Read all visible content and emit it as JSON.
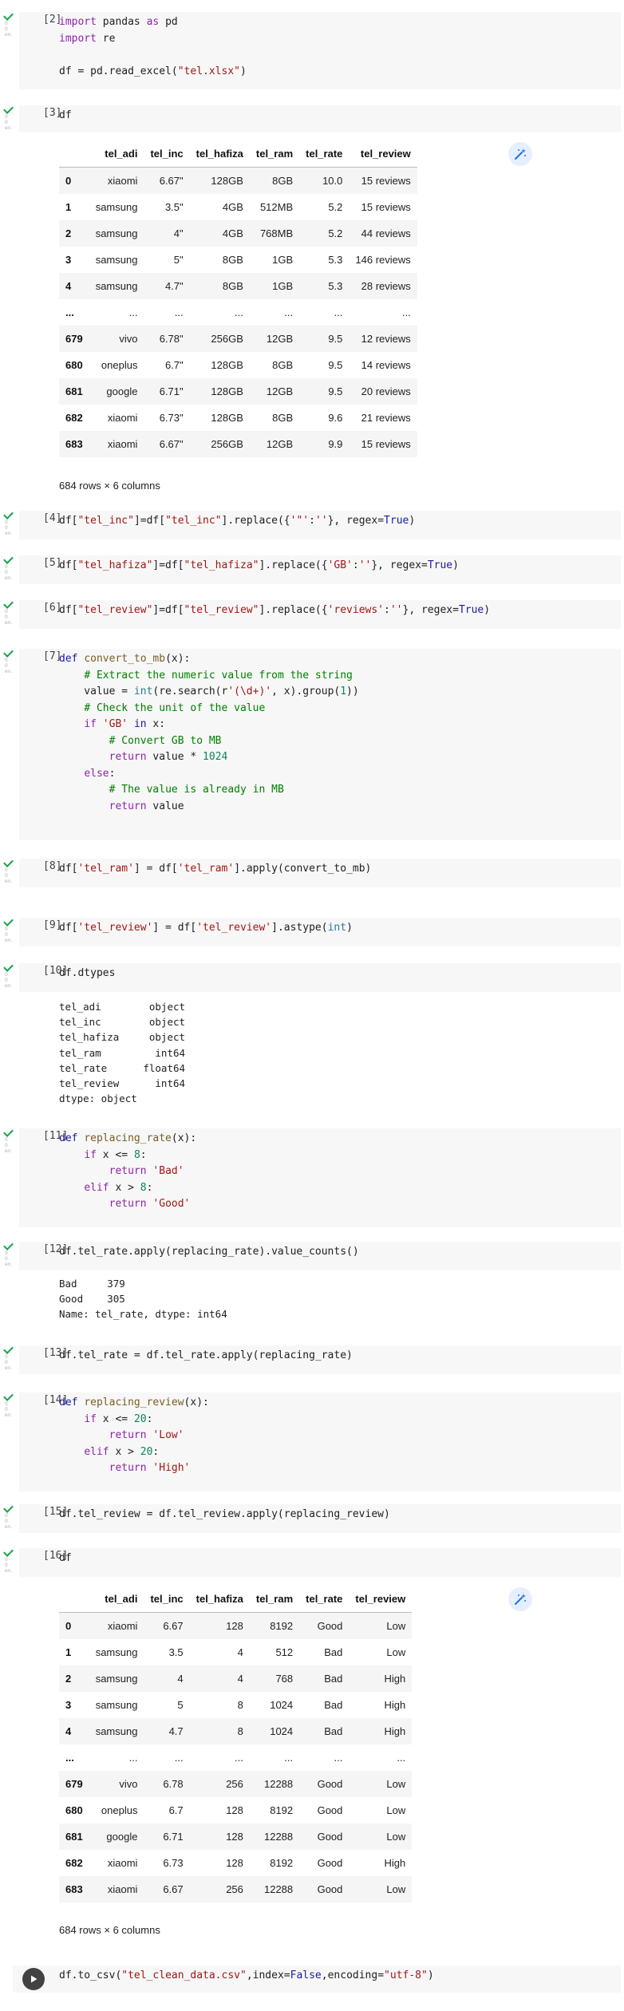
{
  "gutter": {
    "ticks": [
      "0",
      "0",
      "en."
    ]
  },
  "cells": {
    "c2": {
      "number": "[2]"
    },
    "c3": {
      "number": "[3]"
    },
    "c4": {
      "number": "[4]"
    },
    "c5": {
      "number": "[5]"
    },
    "c6": {
      "number": "[6]"
    },
    "c7": {
      "number": "[7]"
    },
    "c8": {
      "number": "[8]"
    },
    "c9": {
      "number": "[9]"
    },
    "c10": {
      "number": "[10]"
    },
    "c11": {
      "number": "[11]"
    },
    "c12": {
      "number": "[12]"
    },
    "c13": {
      "number": "[13]"
    },
    "c14": {
      "number": "[14]"
    },
    "c15": {
      "number": "[15]"
    },
    "c16": {
      "number": "[16]"
    }
  },
  "code": {
    "c2": [
      [
        [
          "k",
          "import"
        ],
        [
          "t",
          " pandas "
        ],
        [
          "k",
          "as"
        ],
        [
          "t",
          " pd"
        ]
      ],
      [
        [
          "k",
          "import"
        ],
        [
          "t",
          " re"
        ]
      ],
      [],
      [
        [
          "t",
          "df = pd.read_excel("
        ],
        [
          "s",
          "\"tel.xlsx\""
        ],
        [
          "t",
          ")"
        ]
      ]
    ],
    "c3": [
      [
        [
          "t",
          "df"
        ]
      ]
    ],
    "c4": [
      [
        [
          "t",
          "df["
        ],
        [
          "s",
          "\"tel_inc\""
        ],
        [
          "t",
          "]=df["
        ],
        [
          "s",
          "\"tel_inc\""
        ],
        [
          "t",
          "].replace({"
        ],
        [
          "s",
          "'\"'"
        ],
        [
          "t",
          ":"
        ],
        [
          "s",
          "''"
        ],
        [
          "t",
          "}, regex="
        ],
        [
          "kb",
          "True"
        ],
        [
          "t",
          ")"
        ]
      ]
    ],
    "c5": [
      [
        [
          "t",
          "df["
        ],
        [
          "s",
          "\"tel_hafiza\""
        ],
        [
          "t",
          "]=df["
        ],
        [
          "s",
          "\"tel_hafiza\""
        ],
        [
          "t",
          "].replace({"
        ],
        [
          "s",
          "'GB'"
        ],
        [
          "t",
          ":"
        ],
        [
          "s",
          "''"
        ],
        [
          "t",
          "}, regex="
        ],
        [
          "kb",
          "True"
        ],
        [
          "t",
          ")"
        ]
      ]
    ],
    "c6": [
      [
        [
          "t",
          "df["
        ],
        [
          "s",
          "\"tel_review\""
        ],
        [
          "t",
          "]=df["
        ],
        [
          "s",
          "\"tel_review\""
        ],
        [
          "t",
          "].replace({"
        ],
        [
          "s",
          "'reviews'"
        ],
        [
          "t",
          ":"
        ],
        [
          "s",
          "''"
        ],
        [
          "t",
          "}, regex="
        ],
        [
          "kb",
          "True"
        ],
        [
          "t",
          ")"
        ]
      ]
    ],
    "c7": [
      [
        [
          "kb",
          "def"
        ],
        [
          "t",
          " "
        ],
        [
          "fn",
          "convert_to_mb"
        ],
        [
          "t",
          "(x):"
        ]
      ],
      [
        [
          "t",
          "    "
        ],
        [
          "c",
          "# Extract the numeric value from the string"
        ]
      ],
      [
        [
          "t",
          "    value = "
        ],
        [
          "bi",
          "int"
        ],
        [
          "t",
          "(re.search(r"
        ],
        [
          "s",
          "'(\\d+)'"
        ],
        [
          "t",
          ", x).group("
        ],
        [
          "n",
          "1"
        ],
        [
          "t",
          "))"
        ]
      ],
      [
        [
          "t",
          "    "
        ],
        [
          "c",
          "# Check the unit of the value"
        ]
      ],
      [
        [
          "t",
          "    "
        ],
        [
          "k",
          "if"
        ],
        [
          "t",
          " "
        ],
        [
          "s",
          "'GB'"
        ],
        [
          "t",
          " "
        ],
        [
          "kb",
          "in"
        ],
        [
          "t",
          " x:"
        ]
      ],
      [
        [
          "t",
          "        "
        ],
        [
          "c",
          "# Convert GB to MB"
        ]
      ],
      [
        [
          "t",
          "        "
        ],
        [
          "k",
          "return"
        ],
        [
          "t",
          " value * "
        ],
        [
          "n",
          "1024"
        ]
      ],
      [
        [
          "t",
          "    "
        ],
        [
          "k",
          "else"
        ],
        [
          "t",
          ":"
        ]
      ],
      [
        [
          "t",
          "        "
        ],
        [
          "c",
          "# The value is already in MB"
        ]
      ],
      [
        [
          "t",
          "        "
        ],
        [
          "k",
          "return"
        ],
        [
          "t",
          " value"
        ]
      ]
    ],
    "c8": [
      [
        [
          "t",
          "df["
        ],
        [
          "s",
          "'tel_ram'"
        ],
        [
          "t",
          "] = df["
        ],
        [
          "s",
          "'tel_ram'"
        ],
        [
          "t",
          "].apply(convert_to_mb)"
        ]
      ]
    ],
    "c9": [
      [
        [
          "t",
          "df["
        ],
        [
          "s",
          "'tel_review'"
        ],
        [
          "t",
          "] = df["
        ],
        [
          "s",
          "'tel_review'"
        ],
        [
          "t",
          "].astype("
        ],
        [
          "bi",
          "int"
        ],
        [
          "t",
          ")"
        ]
      ]
    ],
    "c10": [
      [
        [
          "t",
          "df.dtypes"
        ]
      ]
    ],
    "c11": [
      [
        [
          "kb",
          "def"
        ],
        [
          "t",
          " "
        ],
        [
          "fn",
          "replacing_rate"
        ],
        [
          "t",
          "(x):"
        ]
      ],
      [
        [
          "t",
          "    "
        ],
        [
          "k",
          "if"
        ],
        [
          "t",
          " x <= "
        ],
        [
          "n",
          "8"
        ],
        [
          "t",
          ":"
        ]
      ],
      [
        [
          "t",
          "        "
        ],
        [
          "k",
          "return"
        ],
        [
          "t",
          " "
        ],
        [
          "s",
          "'Bad'"
        ]
      ],
      [
        [
          "t",
          "    "
        ],
        [
          "k",
          "elif"
        ],
        [
          "t",
          " x > "
        ],
        [
          "n",
          "8"
        ],
        [
          "t",
          ":"
        ]
      ],
      [
        [
          "t",
          "        "
        ],
        [
          "k",
          "return"
        ],
        [
          "t",
          " "
        ],
        [
          "s",
          "'Good'"
        ]
      ]
    ],
    "c12": [
      [
        [
          "t",
          "df.tel_rate.apply(replacing_rate).value_counts()"
        ]
      ]
    ],
    "c13": [
      [
        [
          "t",
          "df.tel_rate = df.tel_rate.apply(replacing_rate)"
        ]
      ]
    ],
    "c14": [
      [
        [
          "kb",
          "def"
        ],
        [
          "t",
          " "
        ],
        [
          "fn",
          "replacing_review"
        ],
        [
          "t",
          "(x):"
        ]
      ],
      [
        [
          "t",
          "    "
        ],
        [
          "k",
          "if"
        ],
        [
          "t",
          " x <= "
        ],
        [
          "n",
          "20"
        ],
        [
          "t",
          ":"
        ]
      ],
      [
        [
          "t",
          "        "
        ],
        [
          "k",
          "return"
        ],
        [
          "t",
          " "
        ],
        [
          "s",
          "'Low'"
        ]
      ],
      [
        [
          "t",
          "    "
        ],
        [
          "k",
          "elif"
        ],
        [
          "t",
          " x > "
        ],
        [
          "n",
          "20"
        ],
        [
          "t",
          ":"
        ]
      ],
      [
        [
          "t",
          "        "
        ],
        [
          "k",
          "return"
        ],
        [
          "t",
          " "
        ],
        [
          "s",
          "'High'"
        ]
      ]
    ],
    "c15": [
      [
        [
          "t",
          "df.tel_review = df.tel_review.apply(replacing_review)"
        ]
      ]
    ],
    "c16": [
      [
        [
          "t",
          "df"
        ]
      ]
    ],
    "c17": [
      [
        [
          "t",
          "df.to_csv("
        ],
        [
          "s",
          "\"tel_clean_data.csv\""
        ],
        [
          "t",
          ",index="
        ],
        [
          "kb",
          "False"
        ],
        [
          "t",
          ",encoding="
        ],
        [
          "s",
          "\"utf-8\""
        ],
        [
          "t",
          ")"
        ]
      ]
    ]
  },
  "outputs": {
    "c10": [
      "tel_adi        object",
      "tel_inc        object",
      "tel_hafiza     object",
      "tel_ram         int64",
      "tel_rate      float64",
      "tel_review      int64",
      "dtype: object"
    ],
    "c12": [
      "Bad     379",
      "Good    305",
      "Name: tel_rate, dtype: int64"
    ]
  },
  "tables": {
    "t3": {
      "columns": [
        "",
        "tel_adi",
        "tel_inc",
        "tel_hafiza",
        "tel_ram",
        "tel_rate",
        "tel_review"
      ],
      "rows": [
        [
          "0",
          "xiaomi",
          "6.67\"",
          "128GB",
          "8GB",
          "10.0",
          "15 reviews"
        ],
        [
          "1",
          "samsung",
          "3.5\"",
          "4GB",
          "512MB",
          "5.2",
          "15 reviews"
        ],
        [
          "2",
          "samsung",
          "4\"",
          "4GB",
          "768MB",
          "5.2",
          "44 reviews"
        ],
        [
          "3",
          "samsung",
          "5\"",
          "8GB",
          "1GB",
          "5.3",
          "146 reviews"
        ],
        [
          "4",
          "samsung",
          "4.7\"",
          "8GB",
          "1GB",
          "5.3",
          "28 reviews"
        ],
        [
          "...",
          "...",
          "...",
          "...",
          "...",
          "...",
          "..."
        ],
        [
          "679",
          "vivo",
          "6.78\"",
          "256GB",
          "12GB",
          "9.5",
          "12 reviews"
        ],
        [
          "680",
          "oneplus",
          "6.7\"",
          "128GB",
          "8GB",
          "9.5",
          "14 reviews"
        ],
        [
          "681",
          "google",
          "6.71\"",
          "128GB",
          "12GB",
          "9.5",
          "20 reviews"
        ],
        [
          "682",
          "xiaomi",
          "6.73\"",
          "128GB",
          "8GB",
          "9.6",
          "21 reviews"
        ],
        [
          "683",
          "xiaomi",
          "6.67\"",
          "256GB",
          "12GB",
          "9.9",
          "15 reviews"
        ]
      ],
      "footer": "684 rows × 6 columns"
    },
    "t16": {
      "columns": [
        "",
        "tel_adi",
        "tel_inc",
        "tel_hafiza",
        "tel_ram",
        "tel_rate",
        "tel_review"
      ],
      "rows": [
        [
          "0",
          "xiaomi",
          "6.67",
          "128",
          "8192",
          "Good",
          "Low"
        ],
        [
          "1",
          "samsung",
          "3.5",
          "4",
          "512",
          "Bad",
          "Low"
        ],
        [
          "2",
          "samsung",
          "4",
          "4",
          "768",
          "Bad",
          "High"
        ],
        [
          "3",
          "samsung",
          "5",
          "8",
          "1024",
          "Bad",
          "High"
        ],
        [
          "4",
          "samsung",
          "4.7",
          "8",
          "1024",
          "Bad",
          "High"
        ],
        [
          "...",
          "...",
          "...",
          "...",
          "...",
          "...",
          "..."
        ],
        [
          "679",
          "vivo",
          "6.78",
          "256",
          "12288",
          "Good",
          "Low"
        ],
        [
          "680",
          "oneplus",
          "6.7",
          "128",
          "8192",
          "Good",
          "Low"
        ],
        [
          "681",
          "google",
          "6.71",
          "128",
          "12288",
          "Good",
          "Low"
        ],
        [
          "682",
          "xiaomi",
          "6.73",
          "128",
          "8192",
          "Good",
          "High"
        ],
        [
          "683",
          "xiaomi",
          "6.67",
          "256",
          "12288",
          "Good",
          "Low"
        ]
      ],
      "footer": "684 rows × 6 columns"
    }
  },
  "colors": {
    "keyword": "#8e24aa",
    "keyword_blue": "#1a1aa6",
    "string": "#a31515",
    "number": "#098658",
    "comment": "#008000",
    "builtin": "#267f99",
    "function": "#795e26",
    "success": "#16a34a",
    "code_bg": "#f7f7f7"
  },
  "icons": {
    "status": "check-icon",
    "table_action": "magic-wand-icon",
    "run": "play-icon"
  }
}
